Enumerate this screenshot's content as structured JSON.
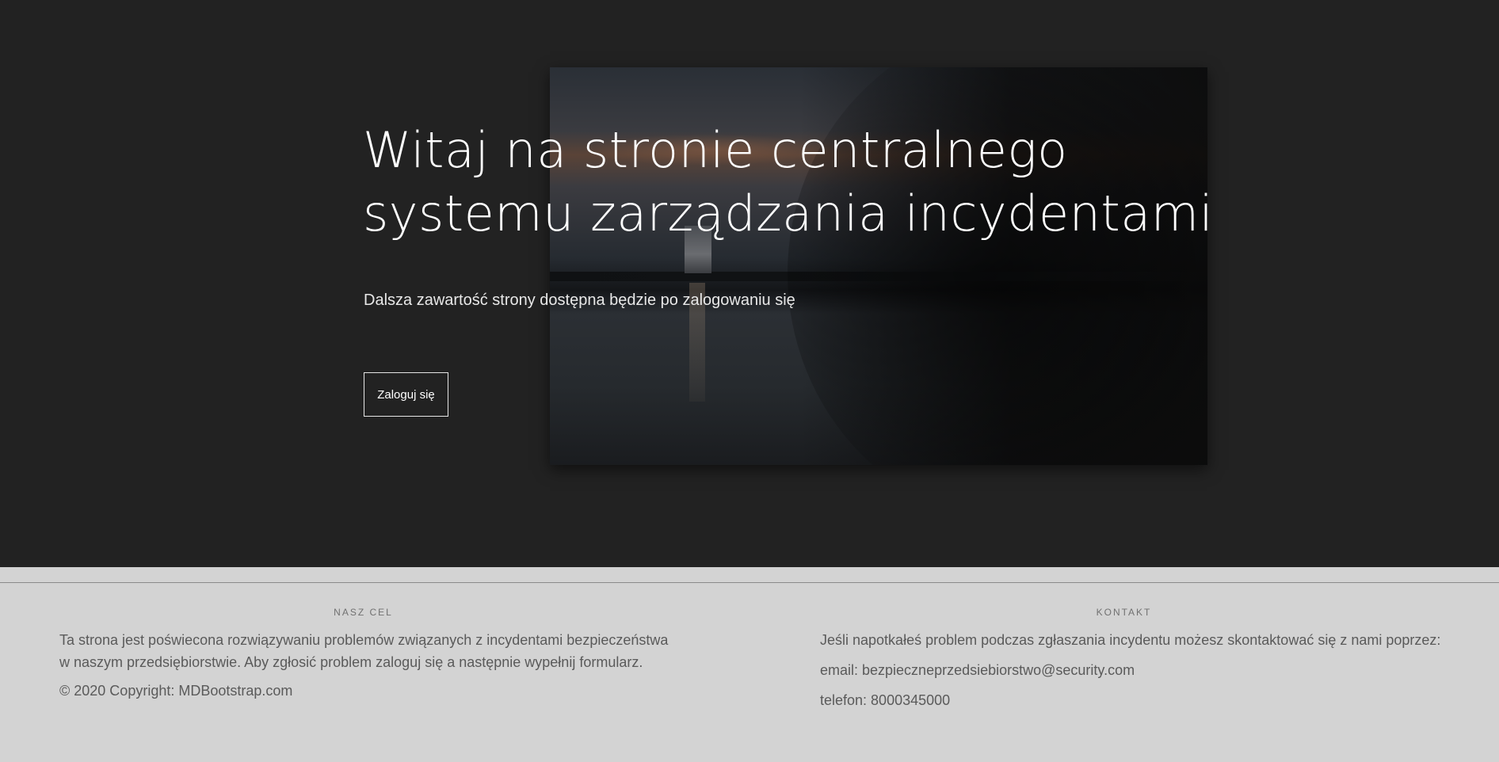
{
  "hero": {
    "title_line1": "Witaj na stronie centralnego",
    "title_line2": "systemu zarządzania incydentami",
    "subtitle": "Dalsza zawartość strony dostępna będzie po zalogowaniu się",
    "login_button_label": "Zaloguj się",
    "background_color": "#222222"
  },
  "footer": {
    "about": {
      "heading": "NASZ CEL",
      "text": "Ta strona jest poświecona rozwiązywaniu problemów związanych z incydentami bezpieczeństwa w naszym przedsiębiorstwie. Aby zgłosić problem zaloguj się a następnie wypełnij formularz.",
      "copyright": "© 2020 Copyright: MDBootstrap.com"
    },
    "contact": {
      "heading": "KONTAKT",
      "intro": "Jeśli napotkałeś problem podczas zgłaszania incydentu możesz skontaktować się z nami poprzez:",
      "email": "email: bezpieczneprzedsiebiorstwo@security.com",
      "phone": "telefon: 8000345000"
    },
    "background_color": "#d3d3d3"
  }
}
